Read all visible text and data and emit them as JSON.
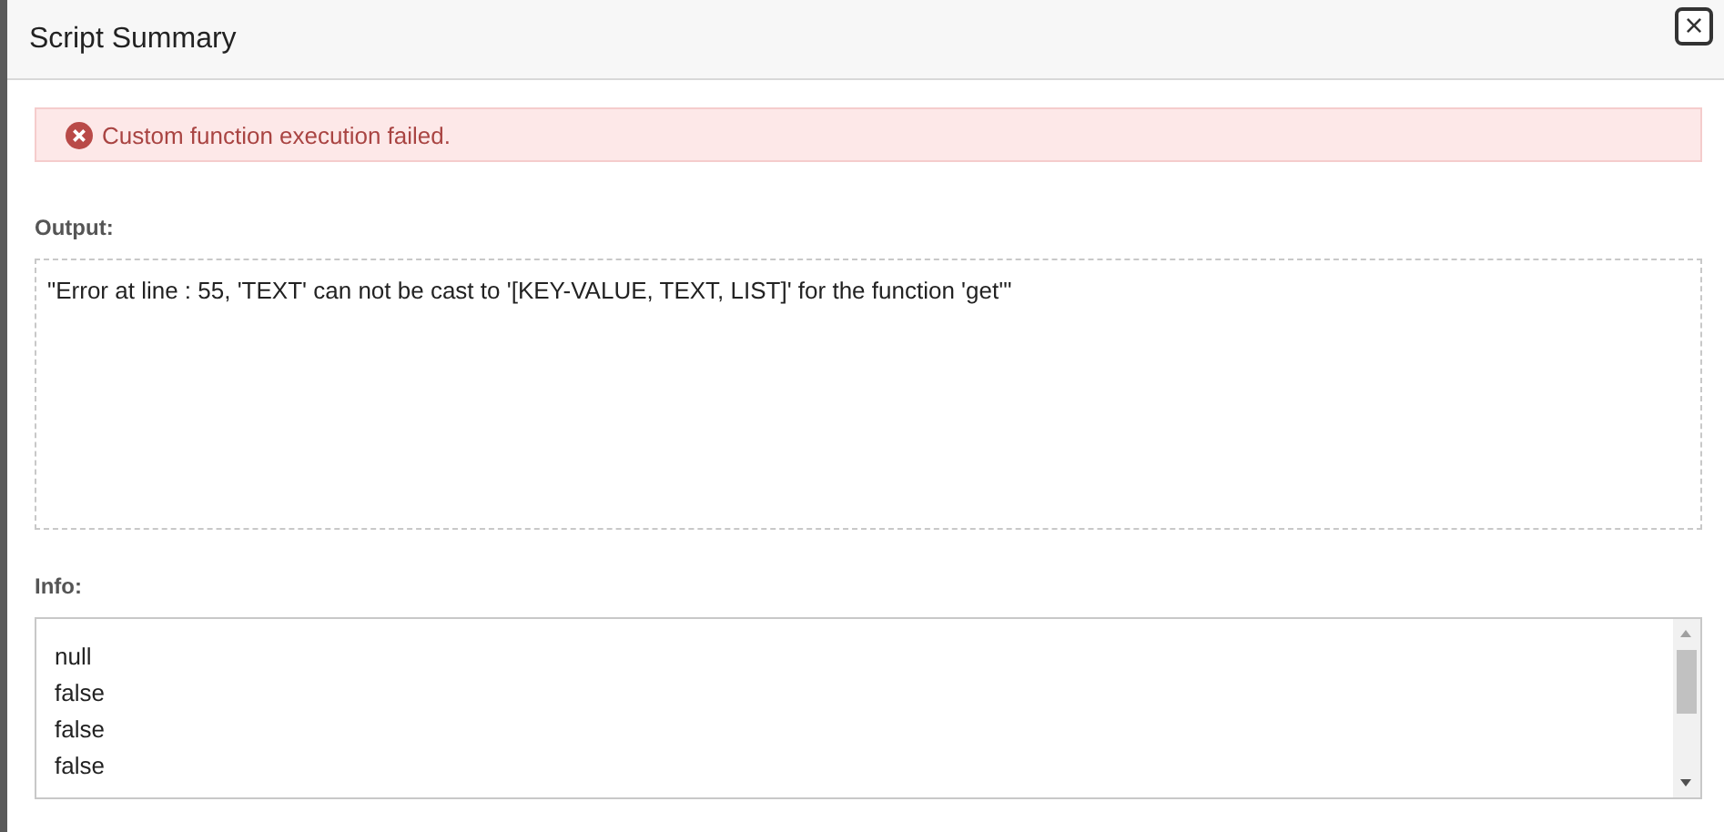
{
  "dialog": {
    "title": "Script Summary",
    "close_label": "×"
  },
  "alert": {
    "kind": "error",
    "message": "Custom function execution failed."
  },
  "output": {
    "label": "Output:",
    "text": "\"Error at line : 55, 'TEXT' can not be cast to '[KEY-VALUE, TEXT, LIST]' for the function 'get'\""
  },
  "info": {
    "label": "Info:",
    "lines": [
      "null",
      "false",
      "false",
      "false"
    ]
  }
}
